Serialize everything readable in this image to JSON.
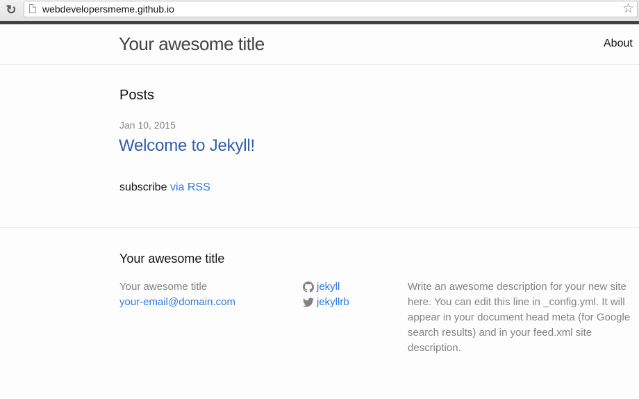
{
  "browser": {
    "url": "webdevelopersmeme.github.io",
    "reload_icon": "reload-icon",
    "page_icon": "page-icon",
    "bookmark_icon": "star-icon"
  },
  "header": {
    "site_title": "Your awesome title",
    "nav": [
      {
        "label": "About"
      }
    ]
  },
  "main": {
    "heading": "Posts",
    "posts": [
      {
        "date": "Jan 10, 2015",
        "title": "Welcome to Jekyll!"
      }
    ],
    "subscribe_text": "subscribe",
    "rss_link": "via RSS"
  },
  "footer": {
    "heading": "Your awesome title",
    "site_name": "Your awesome title",
    "email": "your-email@domain.com",
    "social": [
      {
        "icon": "github-icon",
        "label": "jekyll"
      },
      {
        "icon": "twitter-icon",
        "label": "jekyllrb"
      }
    ],
    "description": "Write an awesome description for your new site here. You can edit this line in _config.yml. It will appear in your document head meta (for Google search results) and in your feed.xml site description."
  },
  "colors": {
    "link": "#2a7ae2",
    "muted": "#828282",
    "topbar": "#424242"
  }
}
